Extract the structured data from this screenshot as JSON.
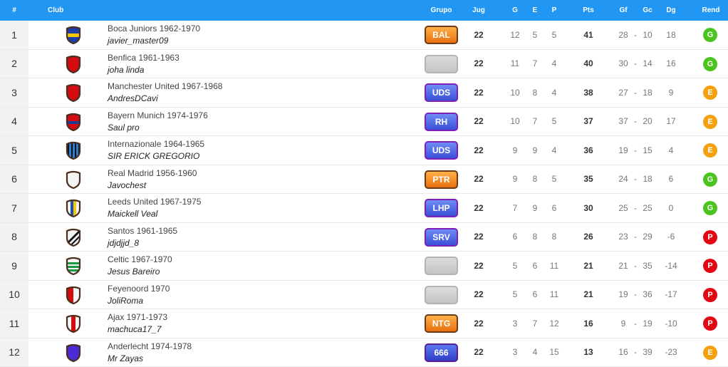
{
  "header": {
    "pos": "#",
    "club": "Club",
    "grupo": "Grupo",
    "jug": "Jug",
    "g": "G",
    "e": "E",
    "p": "P",
    "pts": "Pts",
    "gf": "Gf",
    "gc": "Gc",
    "dg": "Dg",
    "rend": "Rend"
  },
  "colors": {
    "header_bg": "#2196f3",
    "rend_G": "#4cc41f",
    "rend_E": "#f5a00f",
    "rend_P": "#e30613"
  },
  "rows": [
    {
      "pos": "1",
      "club": "Boca Juniors 1962-1970",
      "manager": "javier_master09",
      "grupo": "BAL",
      "grupo_style": "orange",
      "crest": "blue-yellow",
      "jug": "22",
      "g": "12",
      "e": "5",
      "p": "5",
      "pts": "41",
      "gf": "28",
      "sep": "-",
      "gc": "10",
      "dg": "18",
      "rend": "G"
    },
    {
      "pos": "2",
      "club": "Benfica 1961-1963",
      "manager": "joha linda",
      "grupo": "",
      "grupo_style": "empty",
      "crest": "red",
      "jug": "22",
      "g": "11",
      "e": "7",
      "p": "4",
      "pts": "40",
      "gf": "30",
      "sep": "-",
      "gc": "14",
      "dg": "16",
      "rend": "G"
    },
    {
      "pos": "3",
      "club": "Manchester United 1967-1968",
      "manager": "AndresDCavi",
      "grupo": "UDS",
      "grupo_style": "purple",
      "crest": "red",
      "jug": "22",
      "g": "10",
      "e": "8",
      "p": "4",
      "pts": "38",
      "gf": "27",
      "sep": "-",
      "gc": "18",
      "dg": "9",
      "rend": "E"
    },
    {
      "pos": "4",
      "club": "Bayern Munich 1974-1976",
      "manager": "Saul pro",
      "grupo": "RH",
      "grupo_style": "purple",
      "crest": "red-blue",
      "jug": "22",
      "g": "10",
      "e": "7",
      "p": "5",
      "pts": "37",
      "gf": "37",
      "sep": "-",
      "gc": "20",
      "dg": "17",
      "rend": "E"
    },
    {
      "pos": "5",
      "club": "Internazionale 1964-1965",
      "manager": "SIR ERICK GREGORIO",
      "grupo": "UDS",
      "grupo_style": "purple",
      "crest": "blue-black-stripes",
      "jug": "22",
      "g": "9",
      "e": "9",
      "p": "4",
      "pts": "36",
      "gf": "19",
      "sep": "-",
      "gc": "15",
      "dg": "4",
      "rend": "E"
    },
    {
      "pos": "6",
      "club": "Real Madrid 1956-1960",
      "manager": "Javochest",
      "grupo": "PTR",
      "grupo_style": "orange",
      "crest": "white",
      "jug": "22",
      "g": "9",
      "e": "8",
      "p": "5",
      "pts": "35",
      "gf": "24",
      "sep": "-",
      "gc": "18",
      "dg": "6",
      "rend": "G"
    },
    {
      "pos": "7",
      "club": "Leeds United 1967-1975",
      "manager": "Maickell Veal",
      "grupo": "LHP",
      "grupo_style": "purple",
      "crest": "white-blue-yellow",
      "jug": "22",
      "g": "7",
      "e": "9",
      "p": "6",
      "pts": "30",
      "gf": "25",
      "sep": "-",
      "gc": "25",
      "dg": "0",
      "rend": "G"
    },
    {
      "pos": "8",
      "club": "Santos 1961-1965",
      "manager": "jdjdjjd_8",
      "grupo": "SRV",
      "grupo_style": "purple",
      "crest": "black-white-diagonal",
      "jug": "22",
      "g": "6",
      "e": "8",
      "p": "8",
      "pts": "26",
      "gf": "23",
      "sep": "-",
      "gc": "29",
      "dg": "-6",
      "rend": "P"
    },
    {
      "pos": "9",
      "club": "Celtic 1967-1970",
      "manager": "Jesus Bareiro",
      "grupo": "",
      "grupo_style": "empty",
      "crest": "green-hoops",
      "jug": "22",
      "g": "5",
      "e": "6",
      "p": "11",
      "pts": "21",
      "gf": "21",
      "sep": "-",
      "gc": "35",
      "dg": "-14",
      "rend": "P"
    },
    {
      "pos": "10",
      "club": "Feyenoord 1970",
      "manager": "JoliRoma",
      "grupo": "",
      "grupo_style": "empty",
      "crest": "red-white-half",
      "jug": "22",
      "g": "5",
      "e": "6",
      "p": "11",
      "pts": "21",
      "gf": "19",
      "sep": "-",
      "gc": "36",
      "dg": "-17",
      "rend": "P"
    },
    {
      "pos": "11",
      "club": "Ajax 1971-1973",
      "manager": "machuca17_7",
      "grupo": "NTG",
      "grupo_style": "orange",
      "crest": "white-red-stripe",
      "jug": "22",
      "g": "3",
      "e": "7",
      "p": "12",
      "pts": "16",
      "gf": "9",
      "sep": "-",
      "gc": "19",
      "dg": "-10",
      "rend": "P"
    },
    {
      "pos": "12",
      "club": "Anderlecht 1974-1978",
      "manager": "Mr Zayas",
      "grupo": "666",
      "grupo_style": "purple2",
      "crest": "purple",
      "jug": "22",
      "g": "3",
      "e": "4",
      "p": "15",
      "pts": "13",
      "gf": "16",
      "sep": "-",
      "gc": "39",
      "dg": "-23",
      "rend": "E"
    }
  ]
}
